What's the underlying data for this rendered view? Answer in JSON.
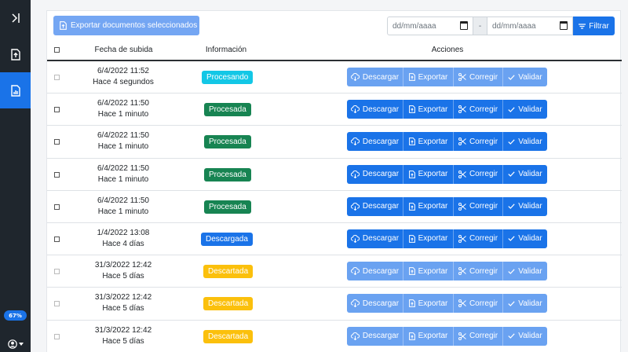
{
  "sidebar": {
    "toggle_icon": "collapse-toggle-icon",
    "items": [
      {
        "name": "upload",
        "icon": "upload-file-icon",
        "active": false
      },
      {
        "name": "reports",
        "icon": "report-chart-icon",
        "active": true
      }
    ],
    "progress": "67%",
    "user_icon": "user-circle-icon"
  },
  "toolbar": {
    "export_selected_label": "Exportar documentos seleccionados",
    "date_from_placeholder": "dd/mm/aaaa",
    "date_separator": "-",
    "date_to_placeholder": "dd/mm/aaaa",
    "filter_label": "Filtrar"
  },
  "table": {
    "headers": {
      "date": "Fecha de subida",
      "info": "Información",
      "actions": "Acciones"
    },
    "action_labels": {
      "download": "Descargar",
      "export": "Exportar",
      "correct": "Corregir",
      "validate": "Validar"
    },
    "rows": [
      {
        "date": "6/4/2022 11:52",
        "relative": "Hace 4 segundos",
        "status": "Procesando",
        "status_type": "procesando",
        "enabled": false
      },
      {
        "date": "6/4/2022 11:50",
        "relative": "Hace 1 minuto",
        "status": "Procesada",
        "status_type": "procesada",
        "enabled": true
      },
      {
        "date": "6/4/2022 11:50",
        "relative": "Hace 1 minuto",
        "status": "Procesada",
        "status_type": "procesada",
        "enabled": true
      },
      {
        "date": "6/4/2022 11:50",
        "relative": "Hace 1 minuto",
        "status": "Procesada",
        "status_type": "procesada",
        "enabled": true
      },
      {
        "date": "6/4/2022 11:50",
        "relative": "Hace 1 minuto",
        "status": "Procesada",
        "status_type": "procesada",
        "enabled": true
      },
      {
        "date": "1/4/2022 13:08",
        "relative": "Hace 4 días",
        "status": "Descargada",
        "status_type": "descargada",
        "enabled": true
      },
      {
        "date": "31/3/2022 12:42",
        "relative": "Hace 5 días",
        "status": "Descartada",
        "status_type": "descartada",
        "enabled": false
      },
      {
        "date": "31/3/2022 12:42",
        "relative": "Hace 5 días",
        "status": "Descartada",
        "status_type": "descartada",
        "enabled": false
      },
      {
        "date": "31/3/2022 12:42",
        "relative": "Hace 5 días",
        "status": "Descartada",
        "status_type": "descartada",
        "enabled": false
      }
    ]
  },
  "colors": {
    "primary": "#1a73e8",
    "sidebar": "#1f262d",
    "procesando": "#13c7e6",
    "procesada": "#178452",
    "descartada": "#fbc00c"
  }
}
